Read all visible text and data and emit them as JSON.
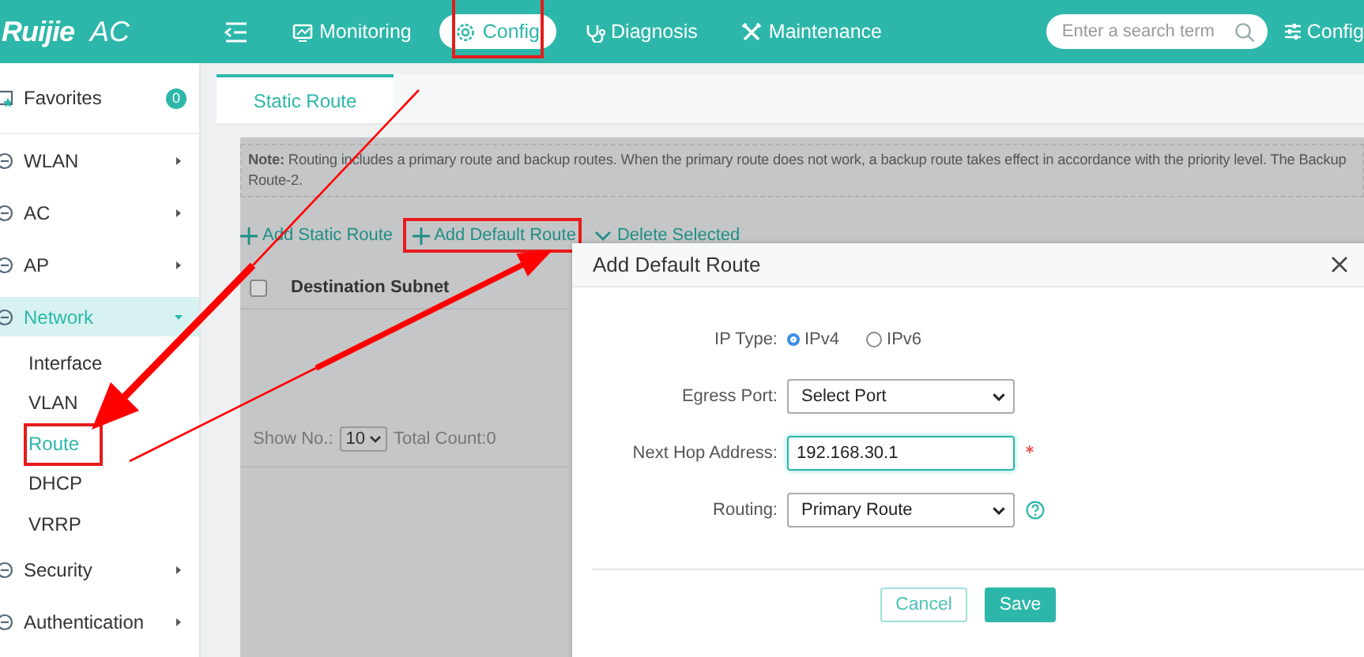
{
  "header": {
    "logo": {
      "brand": "Ruijie",
      "product": "AC"
    },
    "nav": [
      {
        "label": "Monitoring",
        "selected": false,
        "highlighted": false
      },
      {
        "label": "Config",
        "selected": true,
        "highlighted": true
      },
      {
        "label": "Diagnosis",
        "selected": false,
        "highlighted": false
      },
      {
        "label": "Maintenance",
        "selected": false,
        "highlighted": false
      }
    ],
    "search": {
      "placeholder": "Enter a search term"
    },
    "config_link": "Config"
  },
  "sidebar": {
    "favorites": {
      "label": "Favorites",
      "count": "0"
    },
    "items": [
      {
        "label": "WLAN",
        "expanded": false,
        "selected": false
      },
      {
        "label": "AC",
        "expanded": false,
        "selected": false
      },
      {
        "label": "AP",
        "expanded": false,
        "selected": false
      },
      {
        "label": "Network",
        "expanded": true,
        "selected": true,
        "children": [
          {
            "label": "Interface",
            "selected": false,
            "highlighted": false
          },
          {
            "label": "VLAN",
            "selected": false,
            "highlighted": false
          },
          {
            "label": "Route",
            "selected": true,
            "highlighted": true
          },
          {
            "label": "DHCP",
            "selected": false,
            "highlighted": false
          },
          {
            "label": "VRRP",
            "selected": false,
            "highlighted": false
          }
        ]
      },
      {
        "label": "Security",
        "expanded": false,
        "selected": false
      },
      {
        "label": "Authentication",
        "expanded": false,
        "selected": false
      }
    ]
  },
  "tabs": [
    {
      "label": "Static Route",
      "selected": true
    }
  ],
  "note": {
    "lines": [
      "**Note:** Routing includes a primary route and backup routes. When the primary route does not work, a backup route takes effect in accordance with the priority level. The Backup",
      "Route-2."
    ]
  },
  "toolbar": [
    {
      "label": "Add Static Route",
      "highlighted": false
    },
    {
      "label": "Add Default Route",
      "highlighted": true
    },
    {
      "label": "Delete Selected",
      "highlighted": false
    }
  ],
  "table": {
    "select_all": {
      "checked": false
    },
    "columns": [
      "Destination Subnet"
    ]
  },
  "pagination": {
    "show_label": "Show No.:",
    "page_size": "10",
    "total": "Total Count:0"
  },
  "dialog": {
    "title": "Add Default Route",
    "fields": [
      {
        "kind": "radio",
        "label": "IP Type:",
        "options": [
          {
            "label": "IPv4",
            "selected": true
          },
          {
            "label": "IPv6",
            "selected": false
          }
        ]
      },
      {
        "kind": "select",
        "label": "Egress Port:",
        "value": "Select Port"
      },
      {
        "kind": "input",
        "label": "Next Hop Address:",
        "value": "192.168.30.1",
        "required": true,
        "focused": true
      },
      {
        "kind": "select",
        "label": "Routing:",
        "value": "Primary Route",
        "help": true
      }
    ],
    "buttons": [
      {
        "label": "Cancel",
        "kind": "secondary"
      },
      {
        "label": "Save",
        "kind": "primary"
      }
    ]
  }
}
